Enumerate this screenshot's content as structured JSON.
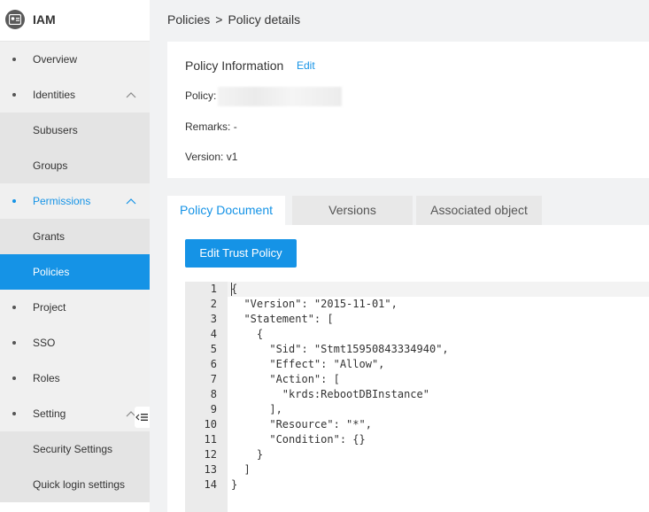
{
  "sidebar": {
    "title": "IAM",
    "items": [
      {
        "label": "Overview"
      },
      {
        "label": "Identities"
      },
      {
        "label": "Subusers"
      },
      {
        "label": "Groups"
      },
      {
        "label": "Permissions"
      },
      {
        "label": "Grants"
      },
      {
        "label": "Policies"
      },
      {
        "label": "Project"
      },
      {
        "label": "SSO"
      },
      {
        "label": "Roles"
      },
      {
        "label": "Setting"
      },
      {
        "label": "Security Settings"
      },
      {
        "label": "Quick login settings"
      }
    ]
  },
  "breadcrumb": {
    "parent": "Policies",
    "separator": ">",
    "current": "Policy details"
  },
  "info": {
    "title": "Policy Information",
    "edit_label": "Edit",
    "policy_label": "Policy:",
    "remarks_label": "Remarks:",
    "remarks_value": "-",
    "version_label": "Version:",
    "version_value": "v1"
  },
  "tabs": [
    {
      "label": "Policy Document"
    },
    {
      "label": "Versions"
    },
    {
      "label": "Associated object"
    }
  ],
  "edit_button_label": "Edit Trust Policy",
  "editor": {
    "line_numbers": [
      "1",
      "2",
      "3",
      "4",
      "5",
      "6",
      "7",
      "8",
      "9",
      "10",
      "11",
      "12",
      "13",
      "14"
    ],
    "lines": [
      "{",
      "  \"Version\": \"2015-11-01\",",
      "  \"Statement\": [",
      "    {",
      "      \"Sid\": \"Stmt15950843334940\",",
      "      \"Effect\": \"Allow\",",
      "      \"Action\": [",
      "        \"krds:RebootDBInstance\"",
      "      ],",
      "      \"Resource\": \"*\",",
      "      \"Condition\": {}",
      "    }",
      "  ]",
      "}"
    ]
  },
  "colors": {
    "accent": "#1593e6",
    "sidebar_sub_bg": "#e4e4e4",
    "page_bg": "#f1f2f3"
  }
}
